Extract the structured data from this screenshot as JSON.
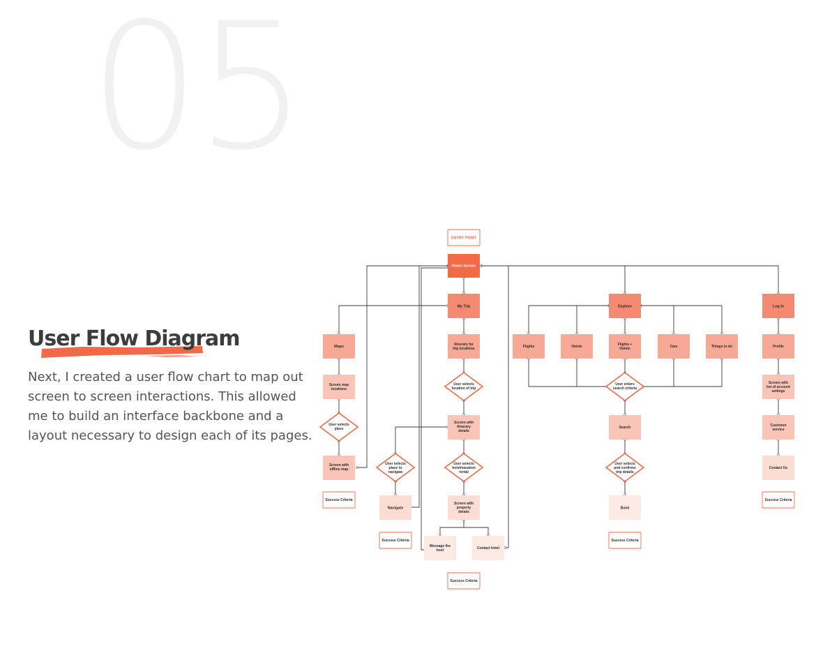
{
  "section": {
    "number": "05",
    "title": "User Flow Diagram",
    "description": "Next, I created a user flow chart to map out screen to screen interactions. This allowed me to build an interface backbone and a layout necessary to design each of its pages."
  },
  "colors": {
    "accent": "#ee6a48",
    "entry_fill": "#f26a47",
    "level1_fill": "#f38a71",
    "level2_fill": "#f8a996",
    "level3_fill": "#fac4b6",
    "level4_fill": "#fcddd4",
    "level5_fill": "#fdeae5",
    "diamond_stroke": "#ee6a48",
    "connector": "#3a3a3a"
  },
  "flow": {
    "entry_point": "ENTRY POINT",
    "home": "Home Screen",
    "my_trip": {
      "label": "My Trip",
      "maps": {
        "label": "Maps",
        "screen_map": [
          "Screen map",
          "locations"
        ],
        "decision": [
          "User selects",
          "place"
        ],
        "offline": [
          "Screen with",
          "offline map"
        ],
        "success": "Success Criteria"
      },
      "itinerary": [
        "Itinerary for",
        "trip locations"
      ],
      "decision_location": [
        "User selects",
        "location of trip"
      ],
      "screen_itinerary": [
        "Screen with",
        "itinerary",
        "details"
      ],
      "decision_navigate": [
        "User selects",
        "place to",
        "navigate"
      ],
      "navigate": "Navigate",
      "navigate_success": "Success Criteria",
      "decision_rental": [
        "User selects",
        "hotel/vacation",
        "rental"
      ],
      "screen_property": [
        "Screen with",
        "property",
        "details"
      ],
      "message_host": [
        "Message the",
        "host"
      ],
      "contact_hotel": "Contact hotel",
      "success": "Success Criteria"
    },
    "explore": {
      "label": "Explore",
      "options": [
        "Flights",
        "Hotels",
        "Flights + Hotels",
        "Cars",
        "Things to do"
      ],
      "decision_search": [
        "User enters",
        "search criteria"
      ],
      "search": "Search",
      "decision_confirm": [
        "User selects",
        "and confirms",
        "trip details"
      ],
      "book": "Book",
      "success": "Success Criteria"
    },
    "login": {
      "label": "Log In",
      "profile": "Profile",
      "account_settings": [
        "Screen with",
        "list of account",
        "settings"
      ],
      "customer_service": [
        "Customer",
        "service"
      ],
      "contact_us": "Contact Us",
      "success": "Success Criteria"
    }
  }
}
